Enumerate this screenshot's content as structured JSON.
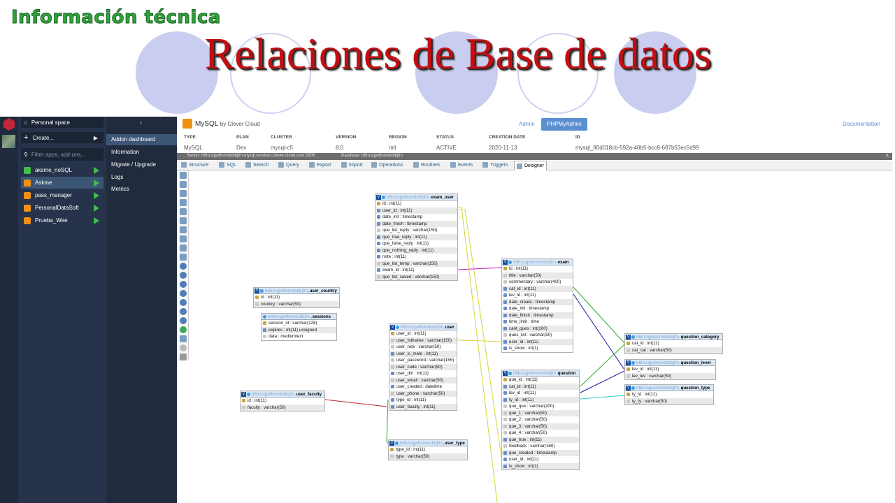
{
  "slide": {
    "subtitle": "Información técnica",
    "title": "Relaciones de Base de datos"
  },
  "apps_panel": {
    "personal_space": "Personal space",
    "create": "Create...",
    "search_placeholder": "Filter apps, add-ons...",
    "apps": [
      {
        "label": "aksme_noSQL",
        "color": "#3fbf4b"
      },
      {
        "label": "Askme",
        "color": "#f29111"
      },
      {
        "label": "pass_manager",
        "color": "#f29111"
      },
      {
        "label": "PersonalDataSoft",
        "color": "#f29111"
      },
      {
        "label": "Prueba_Wee",
        "color": "#f29111"
      }
    ]
  },
  "menu": {
    "items": [
      "Addon dashboard",
      "Information",
      "Migrate / Upgrade",
      "Logs",
      "Metrics"
    ]
  },
  "addon": {
    "name": "MySQL",
    "by": "by Clever Cloud",
    "admin_link": "Admin",
    "pma_button": "PHPMyAdmin",
    "doc_link": "Documentation",
    "info": {
      "headers": [
        "TYPE",
        "PLAN",
        "CLUSTER",
        "VERSION",
        "REGION",
        "STATUS",
        "CREATION DATE",
        "ID"
      ],
      "values": [
        "MySQL",
        "Dev",
        "mysql-c5",
        "8.0",
        "mtl",
        "ACTIVE",
        "2020-11-13",
        "mysql_80d018cb-592a-40b5-bcc8-687b53ec5d99"
      ]
    }
  },
  "pma": {
    "breadcrumb_server": "Server: b6hzsqjw9nmxlobbjfm-mysql.services.clever-cloud.com:3306",
    "breadcrumb_db": "Database: b6hzsqjw9nmxlobbjfm",
    "tabs": [
      "Structure",
      "SQL",
      "Search",
      "Query",
      "Export",
      "Import",
      "Operations",
      "Routines",
      "Events",
      "Triggers",
      "Designer"
    ],
    "db_prefix": "b6hzsqjw9nmxlobbjfm"
  },
  "er_tables": {
    "exam_user": {
      "name": "exam_user",
      "columns": [
        "id : int(11)",
        "user_id : int(11)",
        "date_init : timestamp",
        "date_finish : timestamp",
        "que_list_reply : varchar(150)",
        "que_true_reply : int(11)",
        "que_false_reply : int(11)",
        "que_nothing_reply : int(11)",
        "note : int(11)",
        "que_list_temp : varchar(150)",
        "exam_id : int(11)",
        "que_list_saved : varchar(150)"
      ]
    },
    "exam": {
      "name": "exam",
      "columns": [
        "id : int(11)",
        "title : varchar(50)",
        "commentary : varchar(400)",
        "cat_id : int(11)",
        "lev_id : int(11)",
        "date_create : timestamp",
        "date_init : timestamp",
        "date_finish : timestamp",
        "time_limit : time",
        "cant_ques : int(100)",
        "ques_list : varchar(50)",
        "user_id : int(11)",
        "is_show : int(1)"
      ]
    },
    "user_country": {
      "name": "user_country",
      "columns": [
        "id : int(11)",
        "country : varchar(50)"
      ]
    },
    "sessions": {
      "name": "sessions",
      "columns": [
        "session_id : varchar(128)",
        "expires : int(11) unsigned",
        "data : mediumtext"
      ]
    },
    "user": {
      "name": "user",
      "columns": [
        "user_id : int(11)",
        "user_fullname : varchar(150)",
        "user_nick : varchar(50)",
        "user_is_male : int(11)",
        "user_password : varchar(155)",
        "user_code : varchar(50)",
        "user_dni : int(11)",
        "user_email : varchar(50)",
        "user_created : datetime",
        "user_phone : varchar(50)",
        "type_id : int(11)",
        "user_faculty : int(11)"
      ]
    },
    "user_faculty": {
      "name": "user_faculty",
      "columns": [
        "id : int(11)",
        "faculty : varchar(50)"
      ]
    },
    "user_type": {
      "name": "user_type",
      "columns": [
        "type_id : int(11)",
        "type : varchar(50)"
      ]
    },
    "question": {
      "name": "question",
      "columns": [
        "que_id : int(11)",
        "cat_id : int(11)",
        "lev_id : int(11)",
        "ty_id : int(11)",
        "que_que : varchar(200)",
        "que_1 : varchar(50)",
        "que_2 : varchar(50)",
        "que_3 : varchar(50)",
        "que_4 : varchar(50)",
        "que_true : int(11)",
        "feedback : varchar(160)",
        "que_created : timestamp",
        "user_id : int(11)",
        "is_show : int(1)"
      ]
    },
    "question_category": {
      "name": "question_category",
      "columns": [
        "cat_id : int(11)",
        "cat_cat : varchar(50)"
      ]
    },
    "question_level": {
      "name": "question_level",
      "columns": [
        "lev_id : int(11)",
        "lev_lev : varchar(50)"
      ]
    },
    "question_type": {
      "name": "question_type",
      "columns": [
        "ty_id : int(11)",
        "ty_ty : varchar(50)"
      ]
    }
  }
}
